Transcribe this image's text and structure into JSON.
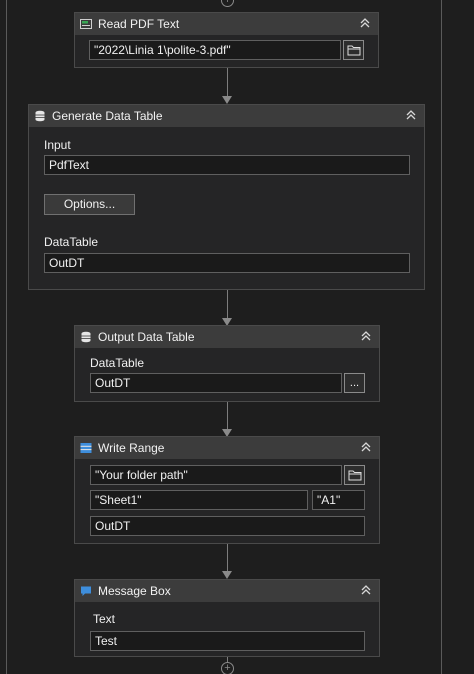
{
  "colors": {
    "canvas": "#1e1e1e",
    "panel": "#252526",
    "header": "#3c3c3c",
    "field_bg": "#1a1a1a",
    "field_border": "#5f5f5f",
    "connector": "#8a8a8a",
    "pdf_icon": "#3aa655",
    "blue_icon": "#3e8edc"
  },
  "read_pdf": {
    "title": "Read PDF Text",
    "icon": "pdf-icon",
    "file_value": "\"2022\\Linia 1\\polite-3.pdf\"",
    "browse_icon": "folder-icon"
  },
  "generate_table": {
    "title": "Generate Data Table",
    "icon": "database-icon",
    "input_label": "Input",
    "input_value": "PdfText",
    "options_label": "Options...",
    "datatable_label": "DataTable",
    "datatable_value": "OutDT"
  },
  "output_table": {
    "title": "Output Data Table",
    "icon": "database-icon",
    "datatable_label": "DataTable",
    "datatable_value": "OutDT",
    "more_label": "..."
  },
  "write_range": {
    "title": "Write Range",
    "icon": "table-icon",
    "path_value": "\"Your folder path\"",
    "sheet_value": "\"Sheet1\"",
    "cell_value": "\"A1\"",
    "datatable_value": "OutDT",
    "browse_icon": "folder-icon"
  },
  "message_box": {
    "title": "Message Box",
    "icon": "message-icon",
    "text_label": "Text",
    "text_value": "Test"
  }
}
